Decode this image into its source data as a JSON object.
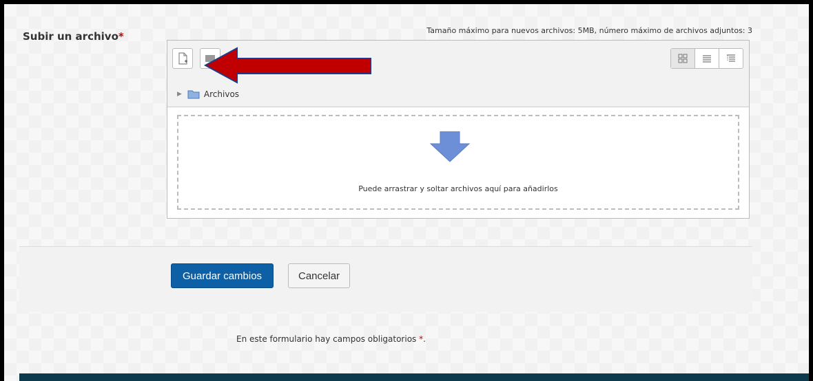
{
  "form": {
    "field_label": "Subir un archivo",
    "required_marker": "*",
    "limits_text": "Tamaño máximo para nuevos archivos: 5MB, número máximo de archivos adjuntos: 3"
  },
  "filemanager": {
    "toolbar": {
      "add_icon": "add-file-icon",
      "folder_icon": "create-folder-icon",
      "views": [
        "view-icons-icon",
        "view-details-icon",
        "view-tree-icon"
      ]
    },
    "path_label": "Archivos",
    "drop_text": "Puede arrastrar y soltar archivos aquí para añadirlos"
  },
  "actions": {
    "save_label": "Guardar cambios",
    "cancel_label": "Cancelar"
  },
  "note": {
    "text": "En este formulario hay campos obligatorios",
    "marker": "*",
    "end": "."
  },
  "colors": {
    "primary": "#0d5fa6",
    "required": "#cc0000",
    "annotation_arrow": "#c00000",
    "annotation_outline": "#1f3a8a",
    "drop_arrow": "#6c8fd8",
    "footer": "#0e3a4e"
  }
}
